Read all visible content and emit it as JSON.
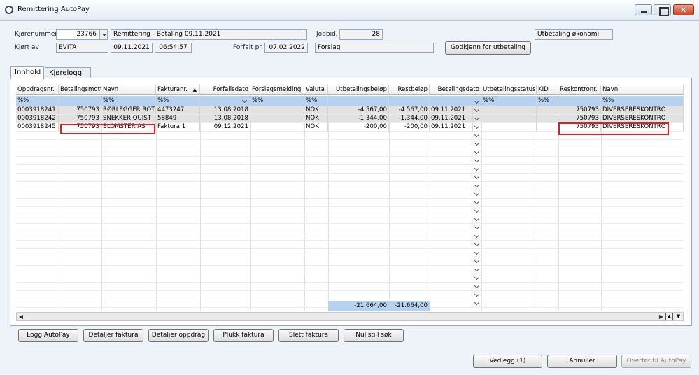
{
  "window": {
    "title": "Remittering AutoPay"
  },
  "header": {
    "kjorenummer_label": "Kjørenummer",
    "kjorenummer_value": "23766",
    "description": "Remittering - Betaling 09.11.2021",
    "jobbid_label": "Jobbid.",
    "jobbid_value": "28",
    "type_value": "Utbetaling økonomi",
    "kjort_av_label": "Kjørt av",
    "kjort_av_value": "EVITA",
    "kjort_date": "09.11.2021",
    "kjort_time": "06:54:57",
    "forfalt_label": "Forfalt pr.",
    "forfalt_value": "07.02.2022",
    "status_value": "Forslag",
    "godkjenn_button": "Godkjenn for utbetaling"
  },
  "tabs": [
    {
      "label": "Innhold",
      "active": true
    },
    {
      "label": "Kjørelogg",
      "active": false
    }
  ],
  "grid": {
    "columns": [
      "Oppdragsnr.",
      "Betalingsmott",
      "Navn",
      "Fakturanr.",
      "Forfallsdato",
      "Forslagsmelding",
      "Valuta",
      "Utbetalingsbeløp",
      "Restbeløp",
      "Betalingsdato",
      "Utbetalingsstatus",
      "KID",
      "Reskontronr.",
      "Navn"
    ],
    "filter": [
      "%%",
      "",
      "%%",
      "%%",
      "",
      "%%",
      "%%",
      "",
      "",
      "",
      "%%",
      "%%",
      "",
      "%%"
    ],
    "rows": [
      {
        "oppdragsnr": "0003918241",
        "betalingsmott": "750793",
        "navn": "RØRLEGGER ROT",
        "fakturanr": "4473247",
        "forfallsdato": "13.08.2018",
        "forslagsmelding": "",
        "valuta": "NOK",
        "utbetalingsbelop": "-4.567,00",
        "restbelop": "-4.567,00",
        "betalingsdato": "09.11.2021",
        "utbetalingsstatus": "",
        "kid": "",
        "reskontronr": "750793",
        "reskontro_navn": "DIVERSERESKONTRO"
      },
      {
        "oppdragsnr": "0003918242",
        "betalingsmott": "750793",
        "navn": "SNEKKER QUIST",
        "fakturanr": "58849",
        "forfallsdato": "13.08.2018",
        "forslagsmelding": "",
        "valuta": "NOK",
        "utbetalingsbelop": "-1.344,00",
        "restbelop": "-1.344,00",
        "betalingsdato": "09.11.2021",
        "utbetalingsstatus": "",
        "kid": "",
        "reskontronr": "750793",
        "reskontro_navn": "DIVERSERESKONTRO"
      },
      {
        "oppdragsnr": "0003918245",
        "betalingsmott": "750793",
        "navn": "BLOMSTER AS",
        "fakturanr": "Faktura 1",
        "forfallsdato": "09.12.2021",
        "forslagsmelding": "",
        "valuta": "NOK",
        "utbetalingsbelop": "-200,00",
        "restbelop": "-200,00",
        "betalingsdato": "09.11.2021",
        "utbetalingsstatus": "",
        "kid": "",
        "reskontronr": "750793",
        "reskontro_navn": "DIVERSERESKONTRO"
      }
    ],
    "sum_utbetalingsbelop": "-21.664,00",
    "sum_restbelop": "-21.664,00"
  },
  "action_buttons": [
    "Logg AutoPay",
    "Detaljer faktura",
    "Detaljer oppdrag",
    "Plukk faktura",
    "Slett faktura",
    "Nullstill søk"
  ],
  "footer_buttons": {
    "vedlegg": "Vedlegg (1)",
    "annuller": "Annuller",
    "overfor": "Overfør til AutoPay"
  },
  "accent_colors": {
    "filter_row": "#b7d2ee",
    "highlight_box": "#e02020"
  }
}
